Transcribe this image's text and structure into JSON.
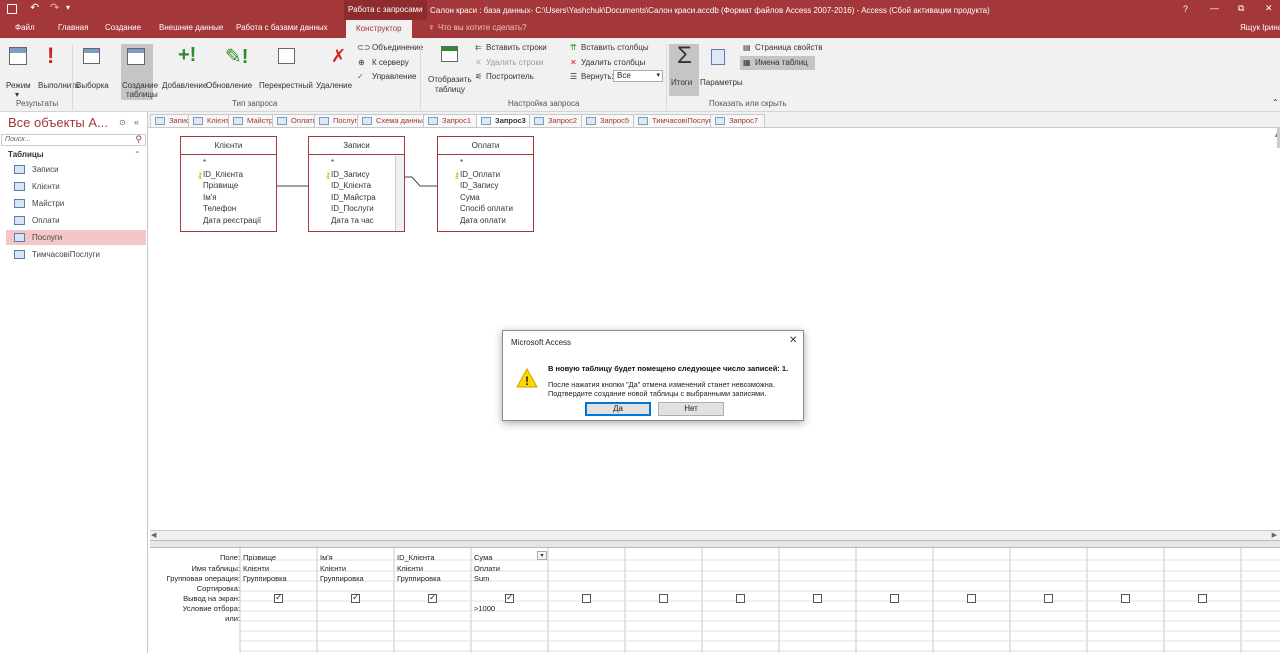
{
  "titlebar": {
    "context_tab": "Работа с запросами",
    "title": "Салон краси : база данных- C:\\Users\\Yashchuk\\Documents\\Салон краси.accdb (Формат файлов Access 2007-2016) - Access (Сбой активации продукта)",
    "help": "?",
    "minimize": "—",
    "restore": "⧉",
    "close": "✕"
  },
  "menu": {
    "file": "Файл",
    "home": "Главная",
    "create": "Создание",
    "external": "Внешние данные",
    "db": "Работа с базами данных",
    "designer": "Конструктор",
    "tellme": "Что вы хотите сделать?",
    "user": "Ящук Ірина"
  },
  "ribbon": {
    "mode": "Режим",
    "run": "Выполнить",
    "select": "Выборка",
    "make_table": "Создание",
    "make_table2": "таблицы",
    "append": "Добавление",
    "update": "Обновление",
    "crosstab": "Перекрестный",
    "delete": "Удаление",
    "union": "Объединение",
    "server": "К серверу",
    "manage": "Управление",
    "show_table": "Отобразить",
    "show_table2": "таблицу",
    "ins_rows": "Вставить строки",
    "del_rows": "Удалить строки",
    "builder": "Построитель",
    "ins_cols": "Вставить столбцы",
    "del_cols": "Удалить столбцы",
    "return": "Вернуть:",
    "return_val": "Все",
    "totals": "Итоги",
    "params": "Параметры",
    "prop_sheet": "Страница свойств",
    "table_names": "Имена таблиц",
    "g_results": "Результаты",
    "g_qtype": "Тип запроса",
    "g_setup": "Настройка запроса",
    "g_show": "Показать или скрыть"
  },
  "nav": {
    "header": "Все объекты А...",
    "search_placeholder": "Поиск...",
    "section": "Таблицы",
    "items": [
      "Записи",
      "Клієнти",
      "Майстри",
      "Оплати",
      "Послуги",
      "ТимчасовіПослуги"
    ]
  },
  "objtabs": [
    "Записи",
    "Клієнти",
    "Майстри",
    "Оплати",
    "Послуги",
    "Схема данных",
    "Запрос1",
    "Запрос3",
    "Запрос2",
    "Запрос5",
    "ТимчасовіПослуги",
    "Запрос7"
  ],
  "tables": [
    {
      "title": "Клієнти",
      "fields": [
        "*",
        "ID_Клієнта",
        "Прізвище",
        "Ім'я",
        "Телефон",
        "Дата реєстрації"
      ]
    },
    {
      "title": "Записи",
      "fields": [
        "*",
        "ID_Запису",
        "ID_Клієнта",
        "ID_Майстра",
        "ID_Послуги",
        "Дата та час"
      ]
    },
    {
      "title": "Оплати",
      "fields": [
        "*",
        "ID_Оплати",
        "ID_Запису",
        "Сума",
        "Спосіб оплати",
        "Дата оплати"
      ]
    }
  ],
  "grid": {
    "labels": [
      "Поле:",
      "Имя таблицы:",
      "Групповая операция:",
      "Сортировка:",
      "Вывод на экран:",
      "Условие отбора:",
      "или:"
    ],
    "columns": [
      {
        "field": "Прізвище",
        "table": "Клієнти",
        "group": "Группировка",
        "criteria": ""
      },
      {
        "field": "Ім'я",
        "table": "Клієнти",
        "group": "Группировка",
        "criteria": ""
      },
      {
        "field": "ID_Клієнта",
        "table": "Клієнти",
        "group": "Группировка",
        "criteria": ""
      },
      {
        "field": "Сума",
        "table": "Оплати",
        "group": "Sum",
        "criteria": ">1000"
      }
    ]
  },
  "dialog": {
    "title": "Microsoft Access",
    "line1": "В новую таблицу будет помещено следующее число записей: 1.",
    "line2": "После нажатия кнопки \"Да\" отмена изменений станет невозможна.",
    "line3": "Подтвердите создание новой таблицы с выбранными записями.",
    "yes": "Да",
    "no": "Нет"
  }
}
